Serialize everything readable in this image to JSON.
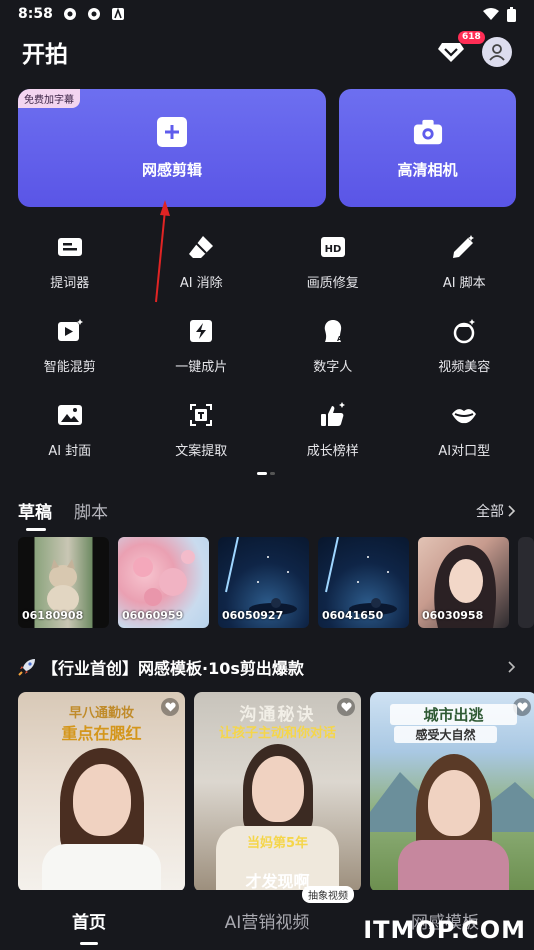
{
  "status": {
    "time": "8:58"
  },
  "header": {
    "title": "开拍",
    "badge": "618"
  },
  "cards": {
    "main": {
      "label": "网感剪辑",
      "tag": "免费加字幕"
    },
    "camera": {
      "label": "高清相机"
    }
  },
  "tools": [
    {
      "label": "提词器",
      "icon": "teleprompter-icon"
    },
    {
      "label": "AI 消除",
      "icon": "eraser-icon"
    },
    {
      "label": "画质修复",
      "icon": "hd-icon"
    },
    {
      "label": "AI 脚本",
      "icon": "magic-pen-icon"
    },
    {
      "label": "智能混剪",
      "icon": "smart-mix-icon"
    },
    {
      "label": "一键成片",
      "icon": "lightning-icon"
    },
    {
      "label": "数字人",
      "icon": "digital-human-icon"
    },
    {
      "label": "视频美容",
      "icon": "beauty-icon"
    },
    {
      "label": "AI 封面",
      "icon": "cover-image-icon"
    },
    {
      "label": "文案提取",
      "icon": "text-extract-icon"
    },
    {
      "label": "成长榜样",
      "icon": "thumbs-up-icon"
    },
    {
      "label": "AI对口型",
      "icon": "lip-sync-icon"
    }
  ],
  "drafts": {
    "tabs": [
      "草稿",
      "脚本"
    ],
    "all_label": "全部",
    "items": [
      "06180908",
      "06060959",
      "06050927",
      "06041650",
      "06030958"
    ]
  },
  "section": {
    "title": "【行业首创】网感模板·10s剪出爆款"
  },
  "templates": [
    {
      "caption_top": "早八通勤妆",
      "caption_mid": "重点在腮红"
    },
    {
      "caption_top": "沟通秘诀",
      "caption_mid": "让孩子主动和你对话",
      "caption_bottom": "当妈第5年",
      "caption_bottom2": "才发现啊"
    },
    {
      "caption_top": "城市出逃",
      "caption_mid": "感受大自然"
    }
  ],
  "bottom_nav": {
    "items": [
      "首页",
      "AI营销视频",
      "网感模板"
    ],
    "badge": "抽象视频"
  },
  "watermark": "ITMOP.COM",
  "colors": {
    "accent": "#5f5cec",
    "background": "#17181d"
  }
}
